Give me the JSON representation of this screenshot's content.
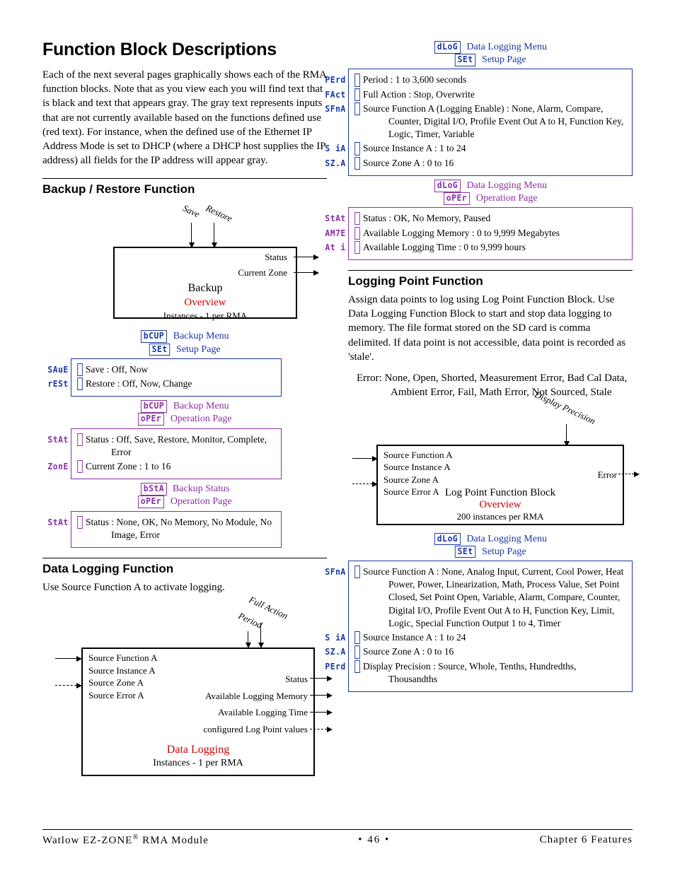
{
  "title": "Function Block Descriptions",
  "intro": "Each of the next several pages graphically shows each of the RMA function blocks. Note that as you view each you will find text that is black and text that appears gray. The gray text represents inputs that are not currently available based on the functions defined use (red text). For instance, when the defined use of the Ethernet IP Address Mode is set to DHCP (where a DHCP host supplies the IP address) all fields for the IP address will appear gray.",
  "backup": {
    "heading": "Backup / Restore Function",
    "diagram": {
      "in_save": "Save",
      "in_restore": "Restore",
      "out_status": "Status",
      "out_czone": "Current Zone",
      "block_title": "Backup",
      "block_sub": "Overview",
      "block_inst": "Instances - 1 per RMA"
    },
    "box1": {
      "menu_seg": "bCUP",
      "menu_txt": "Backup Menu",
      "page_seg": "SEt",
      "page_txt": "Setup Page",
      "rows": [
        {
          "seg": "SAuE",
          "txt": "Save : Off, Now"
        },
        {
          "seg": "rESt",
          "txt": "Restore : Off, Now, Change"
        }
      ]
    },
    "box2": {
      "menu_seg": "bCUP",
      "menu_txt": "Backup Menu",
      "page_seg": "oPEr",
      "page_txt": "Operation Page",
      "rows": [
        {
          "seg": "StAt",
          "txt": "Status : Off, Save, Restore, Monitor, Complete, Error"
        },
        {
          "seg": "ZonE",
          "txt": "Current Zone : 1 to 16"
        }
      ]
    },
    "box3": {
      "menu_seg": "bStA",
      "menu_txt": "Backup Status",
      "page_seg": "oPEr",
      "page_txt": "Operation Page",
      "rows": [
        {
          "seg": "StAt",
          "txt": "Status : None, OK, No Memory, No Module, No Image, Error"
        }
      ]
    }
  },
  "datalog": {
    "heading": "Data Logging Function",
    "intro": "Use Source Function A to activate logging.",
    "diagram": {
      "in_full": "Full Action",
      "in_period": "Period",
      "left": [
        "Source Function A",
        "Source Instance A",
        "Source Zone A",
        "Source Error A"
      ],
      "right": [
        "Status",
        "Available Logging Memory",
        "Available Logging Time",
        "configured Log Point values"
      ],
      "block_title": "Data Logging",
      "block_inst": "Instances - 1 per RMA"
    },
    "box1": {
      "menu_seg": "dLoG",
      "menu_txt": "Data Logging Menu",
      "page_seg": "SEt",
      "page_txt": "Setup Page",
      "rows": [
        {
          "seg": "PErd",
          "txt": "Period : 1 to 3,600 seconds"
        },
        {
          "seg": "FAct",
          "txt": "Full Action : Stop, Overwrite"
        },
        {
          "seg": "SFnA",
          "txt": "Source Function A (Logging Enable) : None, Alarm, Compare, Counter, Digital I/O, Profile Event Out A to H, Function Key, Logic, Timer, Variable"
        },
        {
          "seg": "S iA",
          "txt": "Source Instance A : 1 to 24"
        },
        {
          "seg": "SZ.A",
          "txt": "Source Zone A : 0 to 16"
        }
      ]
    },
    "box2": {
      "menu_seg": "dLoG",
      "menu_txt": "Data Logging Menu",
      "page_seg": "oPEr",
      "page_txt": "Operation Page",
      "rows": [
        {
          "seg": "StAt",
          "txt": "Status : OK, No Memory, Paused"
        },
        {
          "seg": "AM7E",
          "txt": "Available Logging Memory : 0 to 9,999 Megabytes"
        },
        {
          "seg": "At i",
          "txt": "Available Logging Time : 0 to 9,999 hours"
        }
      ]
    }
  },
  "logpoint": {
    "heading": "Logging Point Function",
    "intro": "Assign data points to log using Log Point Function Block. Use Data Logging Function Block to start and stop data logging to memory. The file format stored on the SD card is comma delimited. If data point is not accessible, data point is recorded as 'stale'.",
    "err": "Error: None, Open, Shorted, Measurement Error, Bad Cal Data, Ambient Error, Fail, Math Error, Not Sourced, Stale",
    "diagram": {
      "in_top": "Display Precision",
      "left": [
        "Source Function A",
        "Source Instance A",
        "Source Zone A",
        "Source Error A"
      ],
      "right": "Error",
      "block_title": "Log Point Function Block",
      "block_sub": "Overview",
      "block_inst": "200 instances per RMA"
    },
    "box": {
      "menu_seg": "dLoG",
      "menu_txt": "Data Logging Menu",
      "page_seg": "SEt",
      "page_txt": "Setup Page",
      "rows": [
        {
          "seg": "SFnA",
          "txt": "Source Function A : None,  Analog Input, Current, Cool Power, Heat Power, Power, Linearization, Math,  Process Value, Set Point Closed, Set Point Open, Variable, Alarm, Compare, Counter, Digital I/O, Profile Event Out A to H, Function Key, Limit, Logic, Special Function Output 1 to 4, Timer"
        },
        {
          "seg": "S iA",
          "txt": "Source Instance A : 1 to 24"
        },
        {
          "seg": "SZ.A",
          "txt": "Source Zone A : 0 to 16"
        },
        {
          "seg": "PErd",
          "txt": "Display Precision : Source, Whole, Tenths, Hundredths, Thousandths"
        }
      ]
    }
  },
  "footer": {
    "left": "Watlow EZ-ZONE",
    "left2": " RMA Module",
    "mid": "•  46  •",
    "right": "Chapter 6 Features"
  }
}
